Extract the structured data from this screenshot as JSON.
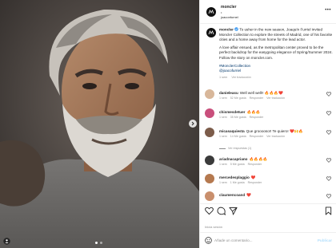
{
  "post": {
    "username": "moncler",
    "separator": "•",
    "location": "joaconfurnel",
    "more_label": "•••"
  },
  "caption": {
    "username": "moncler",
    "text": "To usher in the new season, Joaquín Furriel invited Moncler Collection to explore the streets of Madrid, one of his favorite cities and a home away from home for the lead actor.",
    "para2": "A love affair ensued, as the metropolitan center proved to be the perfect backdrop for the easygoing elegance of Spring/Summer 2024. Follow the story on moncler.com.",
    "tags": "#MonclerCollection\n@joacofurriel",
    "time": "1 sem",
    "translate": "Ver traducción"
  },
  "comments": [
    {
      "user": "danieleasu",
      "text": "Well well well!! 🔥🔥🔥❤️",
      "time": "1 sem",
      "likes": "52 Me gusta",
      "reply": "Responder",
      "translate": "Ver traducción",
      "avatar_color": "#d8b79a"
    },
    {
      "user": "chismesdetuer",
      "text": "🔥🔥🔥",
      "time": "1 sem",
      "likes": "35 Me gusta",
      "reply": "Responder",
      "translate": "",
      "avatar_color": "#c94f7c"
    },
    {
      "user": "micasaquiesta",
      "text": "Que grooooso!! Te quiero! ❤️🙌🔥",
      "time": "1 sem",
      "likes": "14 Me gusta",
      "reply": "Responder",
      "translate": "Ver traducción",
      "avatar_color": "#7c5c4a"
    },
    {
      "user": "ariadnacapriano",
      "text": "🔥🔥🔥🔥",
      "time": "1 sem",
      "likes": "5 Me gusta",
      "reply": "Responder",
      "translate": "",
      "avatar_color": "#3b3b3b"
    },
    {
      "user": "mercedesplaggio",
      "text": "❤️",
      "time": "1 sem",
      "likes": "1 Me gusta",
      "reply": "Responder",
      "translate": "",
      "avatar_color": "#b5794f"
    },
    {
      "user": "claumencoand",
      "text": "❤️",
      "time": "1 sem",
      "likes": "",
      "reply": "Responder",
      "translate": "",
      "avatar_color": "#c98f6d"
    }
  ],
  "view_replies": "Ver respuestas (1)",
  "likes_line": "Inicia sesión",
  "add_comment": {
    "placeholder": "Añade un comentario...",
    "post_label": "Publicar"
  },
  "colors": {
    "accent_link": "#00376b",
    "muted": "#8e8e8e",
    "heart_red": "#ed4956",
    "publish_disabled": "#b2dffc"
  }
}
